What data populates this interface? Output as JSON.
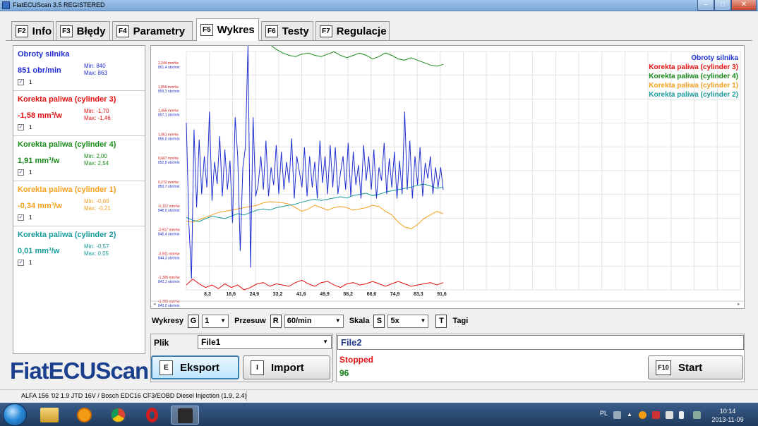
{
  "window": {
    "title": "FiatECUScan 3.5 REGISTERED"
  },
  "tabs": [
    {
      "key": "F2",
      "label": "Info"
    },
    {
      "key": "F3",
      "label": "Błędy"
    },
    {
      "key": "F4",
      "label": "Parametry"
    },
    {
      "key": "F5",
      "label": "Wykres",
      "active": true
    },
    {
      "key": "F6",
      "label": "Testy"
    },
    {
      "key": "F7",
      "label": "Regulacje"
    }
  ],
  "sensors": [
    {
      "name": "Obroty silnika",
      "value": "851 obr/min",
      "min": "Min: 840",
      "max": "Max: 863",
      "checkbox": "1",
      "color": "#1f2fd0",
      "checked": true
    },
    {
      "name": "Korekta paliwa (cylinder 3)",
      "value": "-1,58 mm³/w",
      "min": "Min: -1,70",
      "max": "Max: -1,46",
      "checkbox": "1",
      "color": "#e01010",
      "checked": true
    },
    {
      "name": "Korekta paliwa (cylinder 4)",
      "value": "1,91 mm³/w",
      "min": "Min: 2,00",
      "max": "Max: 2,54",
      "checkbox": "1",
      "color": "#1a8a1a",
      "checked": true
    },
    {
      "name": "Korekta paliwa (cylinder 1)",
      "value": "-0,34 mm³/w",
      "min": "Min: -0,69",
      "max": "Max: -0,21",
      "checkbox": "1",
      "color": "#f5a020",
      "checked": true
    },
    {
      "name": "Korekta paliwa (cylinder 2)",
      "value": "0,01 mm³/w",
      "min": "Min: -0,57",
      "max": "Max: 0,05",
      "checkbox": "1",
      "color": "#1a9a9a",
      "checked": true
    }
  ],
  "logo": "FiatECUScan",
  "chart_data": {
    "type": "line",
    "x_ticks": [
      "8,3",
      "16,6",
      "24,9",
      "33,2",
      "41,6",
      "49,9",
      "58,2",
      "66,6",
      "74,9",
      "83,3",
      "91,6"
    ],
    "y_ticks": [
      {
        "top": "2,244 mm³/w",
        "bottom": "861,4 obr/min"
      },
      {
        "top": "1,850 mm³/w",
        "bottom": "859,3 obr/min"
      },
      {
        "top": "1,455 mm³/w",
        "bottom": "857,1 obr/min"
      },
      {
        "top": "1,061 mm³/w",
        "bottom": "855,0 obr/min"
      },
      {
        "top": "0,667 mm³/w",
        "bottom": "852,8 obr/min"
      },
      {
        "top": "0,272 mm³/w",
        "bottom": "850,7 obr/min"
      },
      {
        "top": "-0,122 mm³/w",
        "bottom": "848,6 obr/min"
      },
      {
        "top": "-0,517 mm³/w",
        "bottom": "846,4 obr/min"
      },
      {
        "top": "-0,911 mm³/w",
        "bottom": "844,3 obr/min"
      },
      {
        "top": "-1,306 mm³/w",
        "bottom": "842,1 obr/min"
      },
      {
        "top": "-1,700 mm³/w",
        "bottom": "840,0 obr/min"
      }
    ],
    "mm_range": [
      -1.7,
      2.244
    ],
    "rpm_range": [
      840.0,
      861.4
    ],
    "x_range": [
      0,
      100
    ],
    "grid": true,
    "legend_position": "top-right",
    "series": [
      {
        "name": "Obroty silnika",
        "color": "#1f2fd0",
        "unit": "obr/min",
        "x": [
          0,
          1,
          2,
          3,
          4,
          5,
          6,
          7,
          8,
          9,
          10,
          11,
          12,
          13,
          14,
          15,
          16,
          17,
          18,
          19,
          20,
          21,
          22,
          23,
          24,
          25,
          26,
          27,
          28,
          29,
          30,
          31,
          32,
          33,
          34,
          35,
          36,
          37,
          38,
          39,
          40,
          41,
          42,
          43,
          44,
          45,
          46,
          47,
          48,
          49,
          50,
          51,
          52,
          53,
          54,
          55,
          56,
          57,
          58,
          59,
          60,
          61,
          62,
          63,
          64,
          65,
          66,
          67,
          68,
          69,
          70,
          71,
          72,
          73,
          74,
          75,
          76,
          77,
          78,
          79,
          80,
          81,
          82,
          83,
          84,
          85,
          86,
          87,
          88,
          89,
          90,
          91,
          92,
          93,
          94,
          95,
          96,
          97,
          98,
          99,
          100
        ],
        "y": [
          855.0,
          846.0,
          841.0,
          854.4,
          847.4,
          853.5,
          848.6,
          852.0,
          849.2,
          856.0,
          848.0,
          851.5,
          849.5,
          853.8,
          848.4,
          852.6,
          849.0,
          851.6,
          846.0,
          855.5,
          852.0,
          843.5,
          851.0,
          852.8,
          862.0,
          842.0,
          855.5,
          848.4,
          849.5,
          852.0,
          849.0,
          853.4,
          848.4,
          851.0,
          849.4,
          853.0,
          848.6,
          852.4,
          849.0,
          851.5,
          849.6,
          853.6,
          848.2,
          852.0,
          850.6,
          849.2,
          852.8,
          848.4,
          852.0,
          849.2,
          851.5,
          848.2,
          853.4,
          849.6,
          852.0,
          848.6,
          853.0,
          849.2,
          852.8,
          848.6,
          850.5,
          852.0,
          849.0,
          853.2,
          848.4,
          852.4,
          849.4,
          851.2,
          848.2,
          853.0,
          849.8,
          852.0,
          849.0,
          852.6,
          848.2,
          851.0,
          849.8,
          853.2,
          848.6,
          851.8,
          849.2,
          852.4,
          848.2,
          851.6,
          848.6,
          856.0,
          849.0,
          853.4,
          848.2,
          852.0,
          849.4,
          852.8,
          848.4,
          851.4,
          850.0,
          852.0,
          848.6,
          851.0,
          849.2,
          851.0,
          849.0
        ]
      },
      {
        "name": "Korekta paliwa (cylinder 3)",
        "color": "#e01010",
        "unit": "mm³/w",
        "x": [
          0,
          2.5,
          5,
          7.5,
          10,
          12.5,
          15,
          17.5,
          20,
          22.5,
          25,
          27.5,
          30,
          32.5,
          35,
          37.5,
          40,
          42.5,
          45,
          47.5,
          50,
          52.5,
          55,
          57.5,
          60,
          62.5,
          65,
          67.5,
          70,
          72.5,
          75,
          77.5,
          80,
          82.5,
          85,
          87.5,
          90,
          92.5,
          95,
          97.5,
          100
        ],
        "y": [
          -1.62,
          -1.52,
          -1.6,
          -1.66,
          -1.62,
          -1.68,
          -1.6,
          -1.66,
          -1.62,
          -1.7,
          -1.66,
          -1.6,
          -1.58,
          -1.64,
          -1.6,
          -1.62,
          -1.64,
          -1.58,
          -1.54,
          -1.6,
          -1.64,
          -1.58,
          -1.56,
          -1.62,
          -1.66,
          -1.6,
          -1.58,
          -1.62,
          -1.6,
          -1.56,
          -1.6,
          -1.64,
          -1.6,
          -1.56,
          -1.6,
          -1.64,
          -1.62,
          -1.6,
          -1.58,
          -1.62,
          -1.58
        ]
      },
      {
        "name": "Korekta paliwa (cylinder 4)",
        "color": "#1a8a1a",
        "unit": "mm³/w",
        "x": [
          0,
          2.5,
          5,
          7.5,
          10,
          12.5,
          15,
          17.5,
          20,
          22.5,
          25,
          27.5,
          30,
          32.5,
          35,
          37.5,
          40,
          42.5,
          45,
          47.5,
          50,
          52.5,
          55,
          57.5,
          60,
          62.5,
          65,
          67.5,
          70,
          72.5,
          75,
          77.5,
          80,
          82.5,
          85,
          87.5,
          90,
          92.5,
          95,
          97.5,
          100
        ],
        "y": [
          2.38,
          2.42,
          2.46,
          2.44,
          2.48,
          2.5,
          2.54,
          2.5,
          2.46,
          2.44,
          2.48,
          2.5,
          2.44,
          2.36,
          2.28,
          2.22,
          2.18,
          2.16,
          2.2,
          2.22,
          2.18,
          2.16,
          2.2,
          2.24,
          2.18,
          2.14,
          2.18,
          2.22,
          2.18,
          2.12,
          2.16,
          2.22,
          2.18,
          2.12,
          2.1,
          2.14,
          2.1,
          2.06,
          2.02,
          2.0,
          2.03
        ]
      },
      {
        "name": "Korekta paliwa (cylinder 1)",
        "color": "#f5a020",
        "unit": "mm³/w",
        "x": [
          0,
          2.5,
          5,
          7.5,
          10,
          12.5,
          15,
          17.5,
          20,
          22.5,
          25,
          27.5,
          30,
          32.5,
          35,
          37.5,
          40,
          42.5,
          45,
          47.5,
          50,
          52.5,
          55,
          57.5,
          60,
          62.5,
          65,
          67.5,
          70,
          72.5,
          75,
          77.5,
          80,
          82.5,
          85,
          87.5,
          90,
          92.5,
          95,
          97.5,
          100
        ],
        "y": [
          -0.56,
          -0.58,
          -0.54,
          -0.5,
          -0.46,
          -0.42,
          -0.4,
          -0.38,
          -0.36,
          -0.34,
          -0.32,
          -0.3,
          -0.26,
          -0.24,
          -0.25,
          -0.26,
          -0.28,
          -0.34,
          -0.4,
          -0.36,
          -0.3,
          -0.34,
          -0.38,
          -0.34,
          -0.32,
          -0.34,
          -0.38,
          -0.36,
          -0.34,
          -0.3,
          -0.32,
          -0.4,
          -0.46,
          -0.58,
          -0.66,
          -0.69,
          -0.62,
          -0.52,
          -0.46,
          -0.4,
          -0.44
        ]
      },
      {
        "name": "Korekta paliwa (cylinder 2)",
        "color": "#1a9a9a",
        "unit": "mm³/w",
        "x": [
          0,
          2.5,
          5,
          7.5,
          10,
          12.5,
          15,
          17.5,
          20,
          22.5,
          25,
          27.5,
          30,
          32.5,
          35,
          37.5,
          40,
          42.5,
          45,
          47.5,
          50,
          52.5,
          55,
          57.5,
          60,
          62.5,
          65,
          67.5,
          70,
          72.5,
          75,
          77.5,
          80,
          82.5,
          85,
          87.5,
          90,
          92.5,
          95,
          97.5,
          100
        ],
        "y": [
          -0.5,
          -0.55,
          -0.57,
          -0.52,
          -0.48,
          -0.5,
          -0.52,
          -0.48,
          -0.44,
          -0.46,
          -0.42,
          -0.38,
          -0.36,
          -0.38,
          -0.34,
          -0.32,
          -0.3,
          -0.28,
          -0.25,
          -0.22,
          -0.2,
          -0.22,
          -0.2,
          -0.18,
          -0.16,
          -0.18,
          -0.14,
          -0.12,
          -0.1,
          -0.14,
          -0.12,
          -0.08,
          -0.06,
          -0.04,
          -0.02,
          0.0,
          0.03,
          0.05,
          0.02,
          -0.02,
          0.0
        ]
      }
    ]
  },
  "controls": {
    "wykresy_label": "Wykresy",
    "wykresy_key": "G",
    "wykresy_value": "1",
    "przesuw_label": "Przesuw",
    "przesuw_key": "R",
    "przesuw_value": "60/min",
    "skala_label": "Skala",
    "skala_key": "S",
    "skala_value": "5x",
    "tagi_key": "T",
    "tagi_label": "Tagi"
  },
  "file_panel": {
    "plik_label": "Plik",
    "plik_value": "File1",
    "eksport_key": "E",
    "eksport_label": "Eksport",
    "import_key": "I",
    "import_label": "Import"
  },
  "log_panel": {
    "file_name": "File2",
    "status": "Stopped",
    "count": "96",
    "start_key": "F10",
    "start_label": "Start"
  },
  "statusbar": {
    "info": "ALFA 156 '02 1.9 JTD 16V / Bosch EDC16 CF3/EOBD Diesel Injection (1.9, 2.4)"
  },
  "taskbar": {
    "lang": "PL",
    "time": "10:14",
    "date": "2013-11-09"
  }
}
